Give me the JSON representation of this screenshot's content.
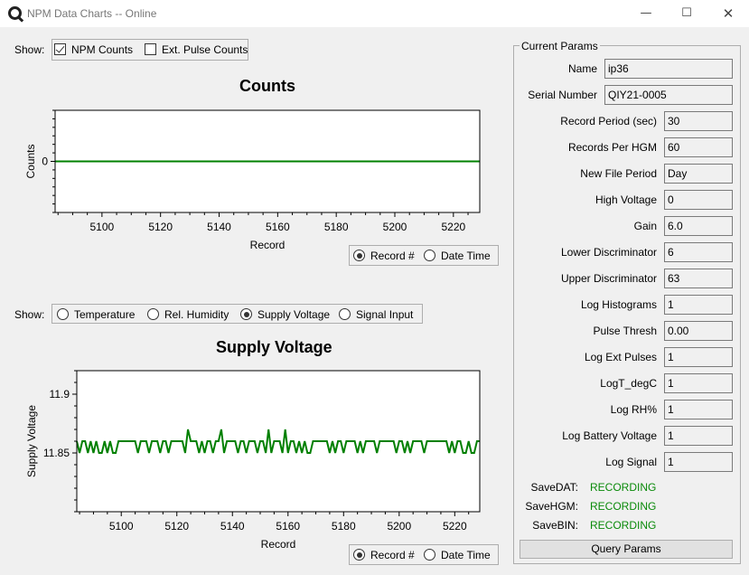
{
  "window": {
    "title": "NPM Data Charts -- Online",
    "minimize_glyph": "—",
    "maximize_glyph": "☐",
    "close_glyph": "✕"
  },
  "counts_panel": {
    "show_label": "Show:",
    "checkboxes": [
      {
        "label": "NPM Counts",
        "checked": true
      },
      {
        "label": "Ext. Pulse Counts",
        "checked": false
      }
    ],
    "x_mode": [
      {
        "label": "Record #",
        "selected": true
      },
      {
        "label": "Date Time",
        "selected": false
      }
    ]
  },
  "voltage_panel": {
    "show_label": "Show:",
    "radios": [
      {
        "label": "Temperature",
        "selected": false
      },
      {
        "label": "Rel. Humidity",
        "selected": false
      },
      {
        "label": "Supply Voltage",
        "selected": true
      },
      {
        "label": "Signal Input",
        "selected": false
      }
    ],
    "x_mode": [
      {
        "label": "Record #",
        "selected": true
      },
      {
        "label": "Date Time",
        "selected": false
      }
    ]
  },
  "chart_data": [
    {
      "type": "line",
      "title": "Counts",
      "xlabel": "Record",
      "ylabel": "Counts",
      "xlim": [
        5084,
        5229
      ],
      "ylim": [
        -1,
        1
      ],
      "x_ticks": [
        5100,
        5120,
        5140,
        5160,
        5180,
        5200,
        5220
      ],
      "y_ticks": [
        0
      ],
      "color": "#008000",
      "series": [
        {
          "x": [
            5084,
            5229
          ],
          "y": [
            0,
            0
          ]
        }
      ]
    },
    {
      "type": "line",
      "title": "Supply Voltage",
      "xlabel": "Record",
      "ylabel": "Supply Voltage",
      "xlim": [
        5084,
        5229
      ],
      "ylim": [
        11.8,
        11.92
      ],
      "x_ticks": [
        5100,
        5120,
        5140,
        5160,
        5180,
        5200,
        5220
      ],
      "y_ticks": [
        11.85,
        11.9
      ],
      "color": "#008000",
      "series": [
        {
          "x_start": 5084,
          "y": [
            11.86,
            11.85,
            11.86,
            11.86,
            11.85,
            11.86,
            11.85,
            11.86,
            11.85,
            11.85,
            11.86,
            11.85,
            11.86,
            11.85,
            11.85,
            11.86,
            11.86,
            11.86,
            11.86,
            11.86,
            11.86,
            11.86,
            11.85,
            11.86,
            11.86,
            11.86,
            11.85,
            11.86,
            11.86,
            11.86,
            11.85,
            11.86,
            11.86,
            11.85,
            11.86,
            11.86,
            11.86,
            11.86,
            11.86,
            11.85,
            11.87,
            11.86,
            11.86,
            11.86,
            11.85,
            11.86,
            11.85,
            11.86,
            11.86,
            11.85,
            11.86,
            11.86,
            11.87,
            11.85,
            11.86,
            11.86,
            11.86,
            11.86,
            11.85,
            11.86,
            11.86,
            11.85,
            11.86,
            11.86,
            11.86,
            11.85,
            11.86,
            11.86,
            11.85,
            11.87,
            11.85,
            11.86,
            11.86,
            11.86,
            11.85,
            11.87,
            11.85,
            11.86,
            11.86,
            11.85,
            11.86,
            11.85,
            11.86,
            11.85,
            11.85,
            11.86,
            11.86,
            11.86,
            11.86,
            11.86,
            11.86,
            11.85,
            11.86,
            11.85,
            11.86,
            11.86,
            11.85,
            11.86,
            11.86,
            11.86,
            11.86,
            11.85,
            11.86,
            11.85,
            11.86,
            11.86,
            11.86,
            11.86,
            11.85,
            11.86,
            11.86,
            11.86,
            11.86,
            11.86,
            11.86,
            11.85,
            11.86,
            11.86,
            11.85,
            11.86,
            11.85,
            11.86,
            11.86,
            11.86,
            11.86,
            11.85,
            11.86,
            11.86,
            11.86,
            11.86,
            11.86,
            11.86,
            11.86,
            11.86,
            11.85,
            11.86,
            11.85,
            11.86,
            11.86,
            11.85,
            11.85,
            11.86,
            11.85,
            11.85,
            11.86,
            11.86
          ]
        }
      ]
    }
  ],
  "params": {
    "title": "Current Params",
    "fields": [
      {
        "label": "Name",
        "value": "ip36"
      },
      {
        "label": "Serial Number",
        "value": "QIY21-0005"
      },
      {
        "label": "Record Period (sec)",
        "value": "30"
      },
      {
        "label": "Records Per HGM",
        "value": "60"
      },
      {
        "label": "New File Period",
        "value": "Day"
      },
      {
        "label": "High Voltage",
        "value": "0"
      },
      {
        "label": "Gain",
        "value": "6.0"
      },
      {
        "label": "Lower Discriminator",
        "value": "6"
      },
      {
        "label": "Upper Discriminator",
        "value": "63"
      },
      {
        "label": "Log Histograms",
        "value": "1"
      },
      {
        "label": "Pulse Thresh",
        "value": "0.00"
      },
      {
        "label": "Log Ext Pulses",
        "value": "1"
      },
      {
        "label": "LogT_degC",
        "value": "1"
      },
      {
        "label": "Log RH%",
        "value": "1"
      },
      {
        "label": "Log Battery Voltage",
        "value": "1"
      },
      {
        "label": "Log Signal",
        "value": "1"
      }
    ],
    "status": [
      {
        "label": "SaveDAT:",
        "value": "RECORDING"
      },
      {
        "label": "SaveHGM:",
        "value": "RECORDING"
      },
      {
        "label": "SaveBIN:",
        "value": "RECORDING"
      }
    ],
    "status_color": "#0a8a0a",
    "query_button": "Query Params"
  }
}
